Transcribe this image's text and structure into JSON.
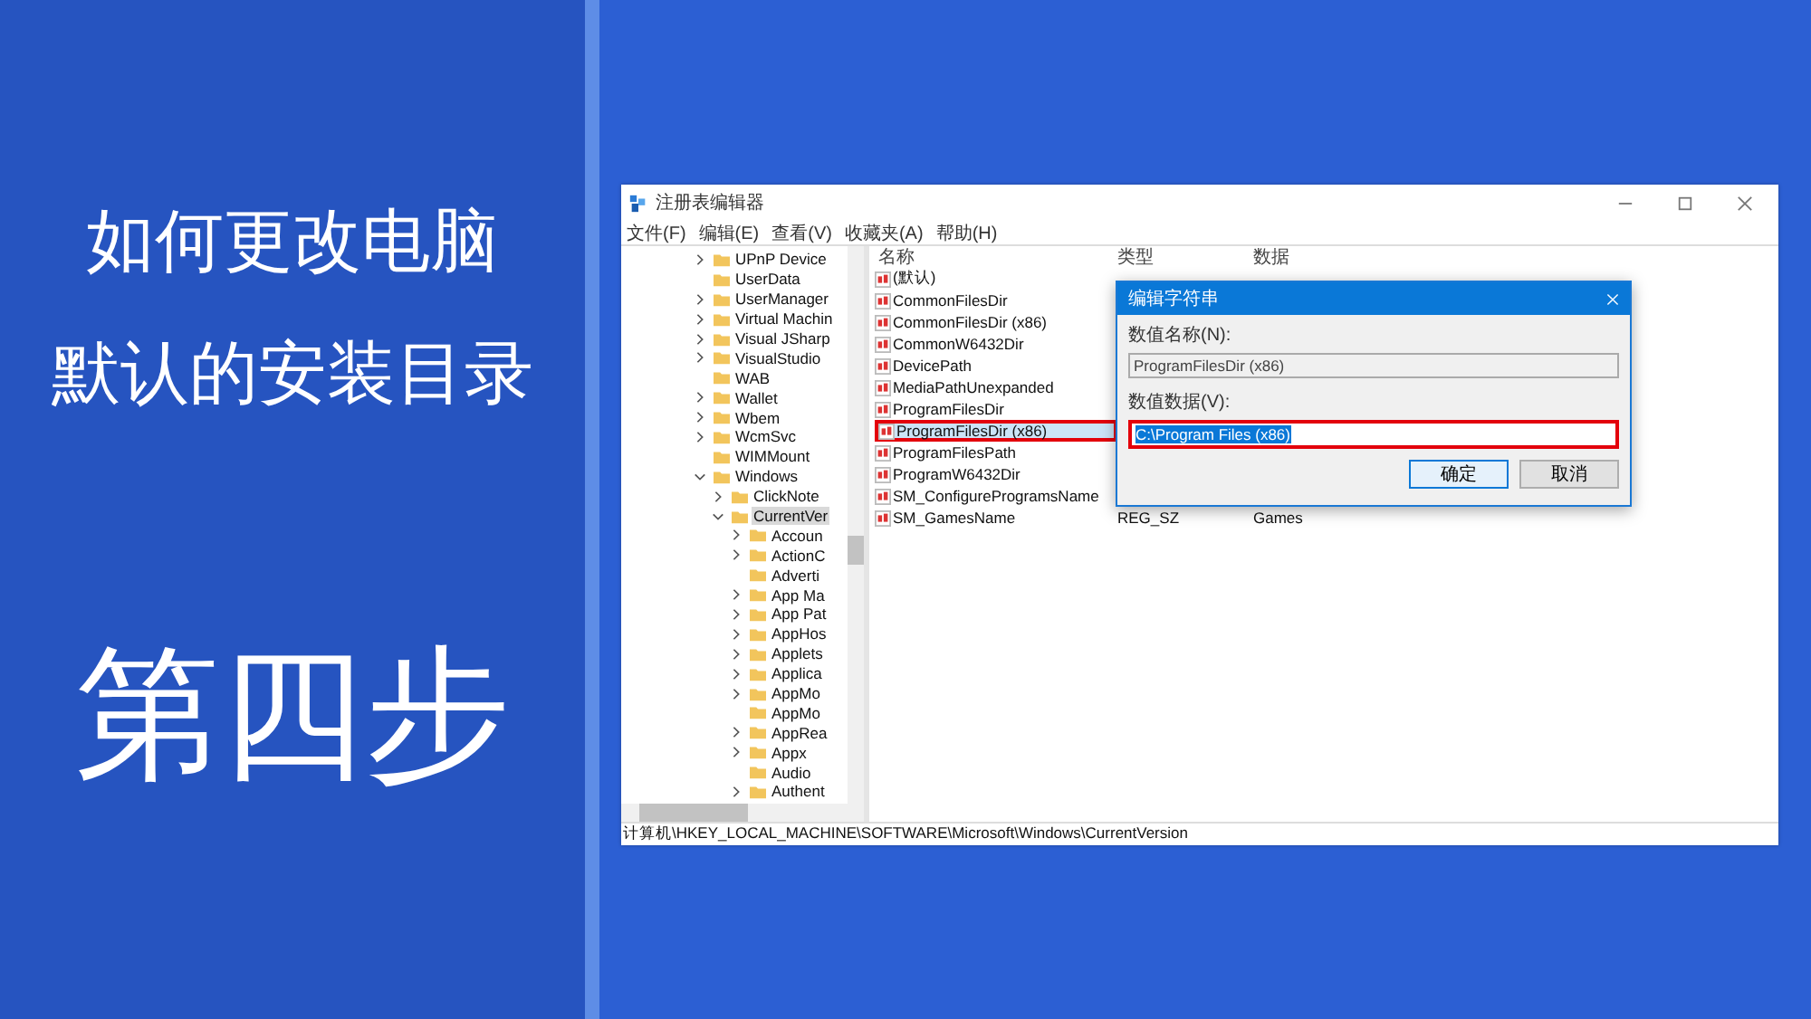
{
  "slide": {
    "heading_lines": [
      "如何更改电脑",
      "默认的安装目录"
    ],
    "step": "第四步"
  },
  "window": {
    "title": "注册表编辑器"
  },
  "menu": [
    "文件(F)",
    "编辑(E)",
    "查看(V)",
    "收藏夹(A)",
    "帮助(H)"
  ],
  "tree": [
    {
      "label": "UPnP Device",
      "expanded": false
    },
    {
      "label": "UserData"
    },
    {
      "label": "UserManager",
      "expanded": false
    },
    {
      "label": "Virtual Machin",
      "expanded": false
    },
    {
      "label": "Visual JSharp",
      "expanded": false
    },
    {
      "label": "VisualStudio",
      "expanded": false
    },
    {
      "label": "WAB"
    },
    {
      "label": "Wallet",
      "expanded": false
    },
    {
      "label": "Wbem",
      "expanded": false
    },
    {
      "label": "WcmSvc",
      "expanded": false
    },
    {
      "label": "WIMMount"
    },
    {
      "label": "Windows",
      "expanded": true,
      "children": [
        {
          "label": "ClickNote",
          "expanded": false
        },
        {
          "label": "CurrentVer",
          "expanded": true,
          "selected": true,
          "children": [
            {
              "label": "Accoun",
              "expanded": false
            },
            {
              "label": "ActionC",
              "expanded": false
            },
            {
              "label": "Adverti"
            },
            {
              "label": "App Ma",
              "expanded": false
            },
            {
              "label": "App Pat",
              "expanded": false
            },
            {
              "label": "AppHos",
              "expanded": false
            },
            {
              "label": "Applets",
              "expanded": false
            },
            {
              "label": "Applica",
              "expanded": false
            },
            {
              "label": "AppMo",
              "expanded": false
            },
            {
              "label": "AppMo"
            },
            {
              "label": "AppRea",
              "expanded": false
            },
            {
              "label": "Appx",
              "expanded": false
            },
            {
              "label": "Audio"
            },
            {
              "label": "Authent",
              "expanded": false
            }
          ]
        }
      ]
    }
  ],
  "columns": [
    "名称",
    "类型",
    "数据"
  ],
  "values": [
    {
      "name": "(默认)",
      "selected": false,
      "marked": false
    },
    {
      "name": "CommonFilesDir",
      "selected": false,
      "marked": false
    },
    {
      "name": "CommonFilesDir (x86)",
      "selected": false,
      "marked": false
    },
    {
      "name": "CommonW6432Dir",
      "selected": false,
      "marked": false
    },
    {
      "name": "DevicePath",
      "selected": false,
      "marked": false
    },
    {
      "name": "MediaPathUnexpanded",
      "selected": false,
      "marked": false
    },
    {
      "name": "ProgramFilesDir",
      "selected": false,
      "marked": false
    },
    {
      "name": "ProgramFilesDir (x86)",
      "selected": true,
      "marked": true
    },
    {
      "name": "ProgramFilesPath",
      "selected": false,
      "marked": false
    },
    {
      "name": "ProgramW6432Dir",
      "selected": false,
      "marked": false
    },
    {
      "name": "SM_ConfigureProgramsName",
      "selected": false,
      "marked": false
    },
    {
      "name": "SM_GamesName",
      "type": "REG_SZ",
      "data": "Games",
      "selected": false,
      "marked": false
    }
  ],
  "status_bar": "计算机\\HKEY_LOCAL_MACHINE\\SOFTWARE\\Microsoft\\Windows\\CurrentVersion",
  "dialog": {
    "title": "编辑字符串",
    "name_label": "数值名称(N):",
    "name_value": "ProgramFilesDir (x86)",
    "data_label": "数值数据(V):",
    "data_value": "C:\\Program Files (x86)",
    "data_marked": true,
    "buttons": [
      {
        "label": "确定",
        "default": true
      },
      {
        "label": "取消",
        "default": false
      }
    ]
  }
}
